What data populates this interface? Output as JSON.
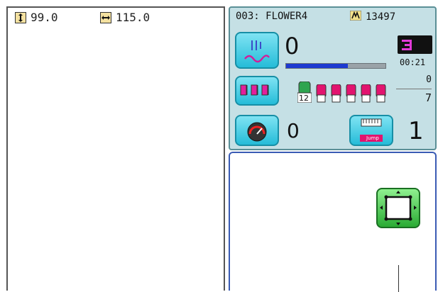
{
  "dimensions": {
    "height_value": "99.0",
    "width_value": "115.0"
  },
  "header": {
    "design_label": "003: FLOWER4",
    "stitch_count": "13497"
  },
  "status": {
    "stitch_counter": "0",
    "progress_fraction": 0.62,
    "elapsed_time": "00:21"
  },
  "colors": {
    "current": "0",
    "total": "7",
    "first_spool_label": "12"
  },
  "speed": {
    "value": "0"
  },
  "jump": {
    "icon_label": "Jump",
    "value": "1"
  }
}
